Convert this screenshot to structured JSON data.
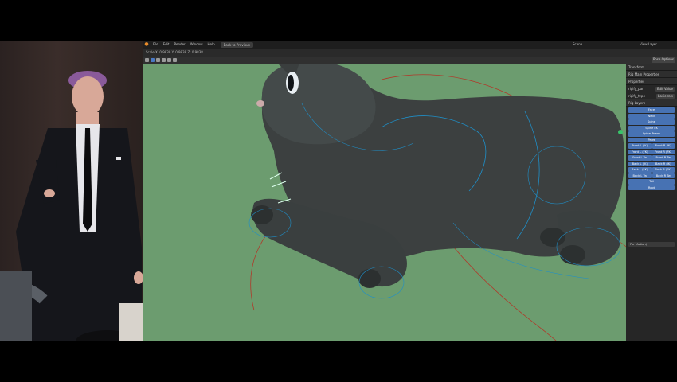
{
  "app": {
    "menu": [
      "File",
      "Edit",
      "Render",
      "Window",
      "Help"
    ],
    "workspace_tab": "Back to Previous",
    "scene_label": "Scene",
    "view_layer_label": "View Layer"
  },
  "header2": {
    "readout": "Scale X: 0.9838  Y: 0.9838  Z: 0.9838"
  },
  "header3": {
    "pose_options": "Pose Options"
  },
  "npanel": {
    "sections": [
      "Transform",
      "Rig Main Properties",
      "Properties",
      "Rig Layers"
    ],
    "props": [
      {
        "label": "rigify_par",
        "value": "Edit Value"
      },
      {
        "label": "rigify_type",
        "value": "basic.raw"
      }
    ],
    "rig_layers_single": [
      "Face",
      "Neck",
      "Spine",
      "Spine FK",
      "Spine Tweak",
      "Paws"
    ],
    "rig_layers_pairs": [
      [
        "Front L (IK)",
        "Front R (IK)"
      ],
      [
        "Front L (FK)",
        "Front R (FK)"
      ],
      [
        "Front L Tw",
        "Front R Tw"
      ],
      [
        "Back L (IK)",
        "Back R (IK)"
      ],
      [
        "Back L (FK)",
        "Back R (FK)"
      ],
      [
        "Back L Tw",
        "Back R Tw"
      ]
    ],
    "rig_layers_tail": [
      "Tail",
      "Root"
    ],
    "bottom_field": "Pur (Action)"
  },
  "colors": {
    "viewport_bg": "#6c9c6f",
    "cat_body": "#3c4040",
    "bone_blue": "#1f8fc8",
    "bone_red": "#b0392a",
    "layer_button": "#4772b3",
    "brand": "#e98b2a"
  }
}
